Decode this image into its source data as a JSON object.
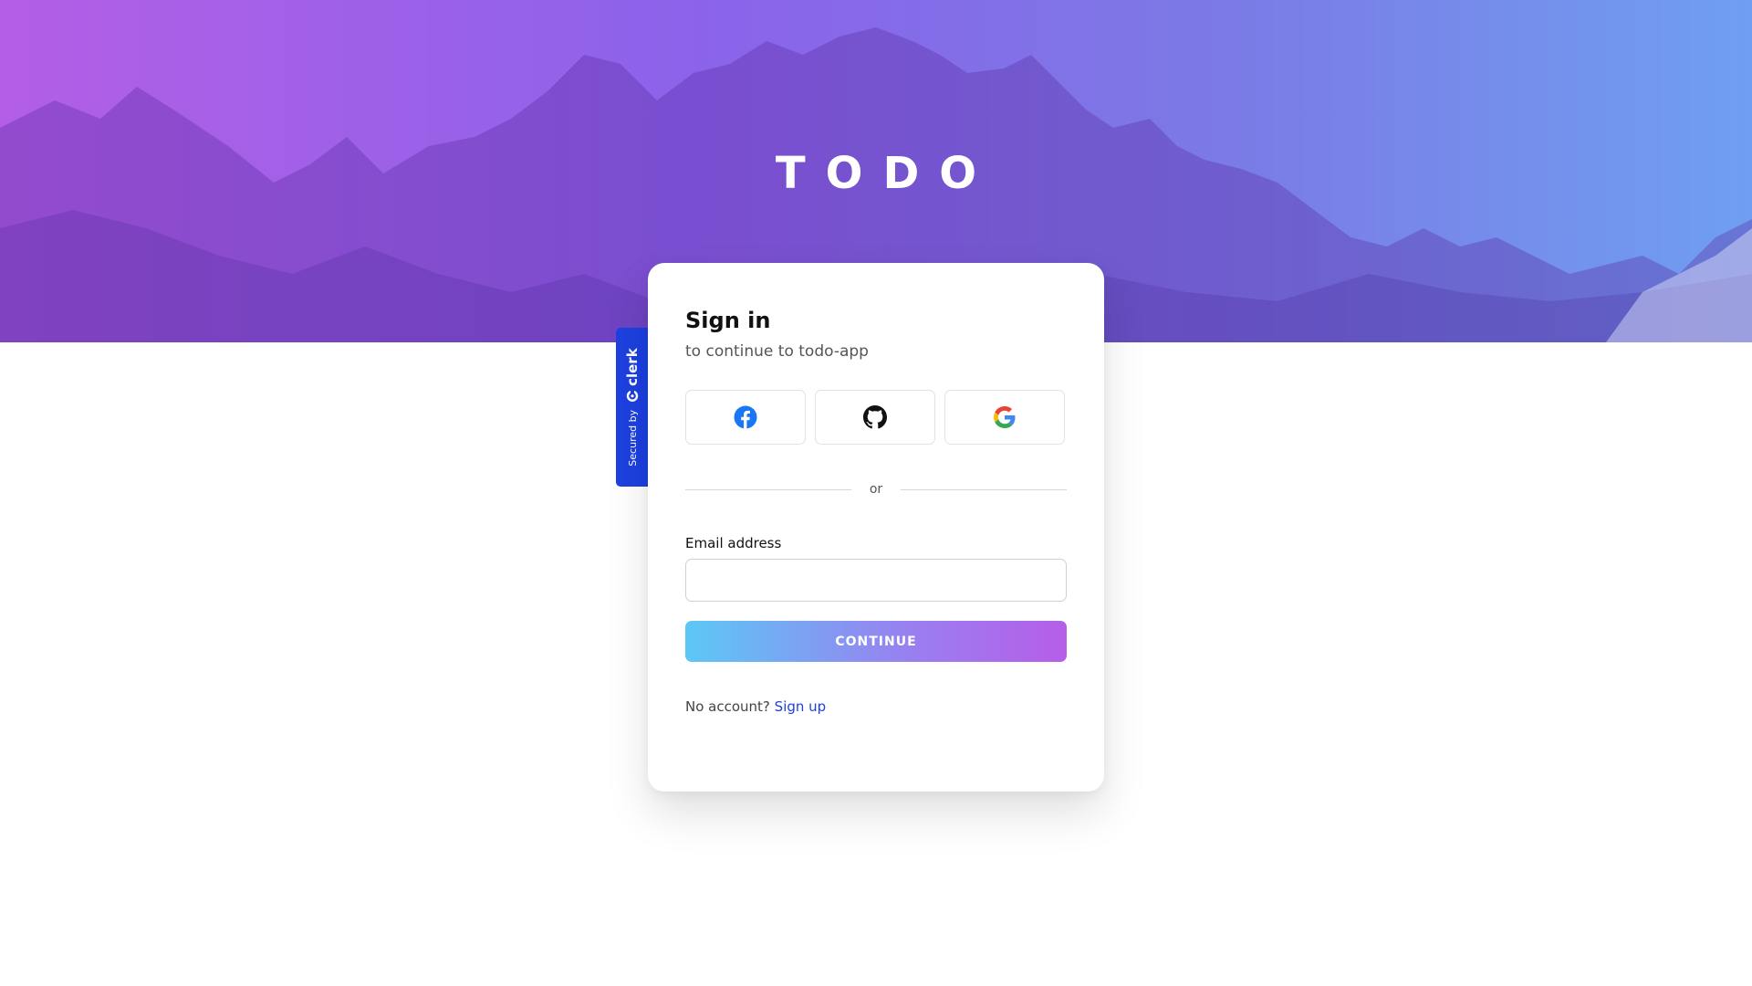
{
  "app": {
    "title": "TODO"
  },
  "clerk_badge": {
    "secured_by": "Secured by",
    "brand": "clerk"
  },
  "signin": {
    "title": "Sign in",
    "subtitle": "to continue to todo-app",
    "social": [
      {
        "provider": "Facebook",
        "icon": "facebook-icon"
      },
      {
        "provider": "GitHub",
        "icon": "github-icon"
      },
      {
        "provider": "Google",
        "icon": "google-icon"
      }
    ],
    "divider_text": "or",
    "email_label": "Email address",
    "email_value": "",
    "continue_label": "CONTINUE",
    "no_account_text": "No account?",
    "signup_link": "Sign up"
  },
  "colors": {
    "accent": "#1d40e0",
    "gradient_start": "#5cc8f5",
    "gradient_end": "#b65ee8",
    "facebook": "#1877f2"
  }
}
